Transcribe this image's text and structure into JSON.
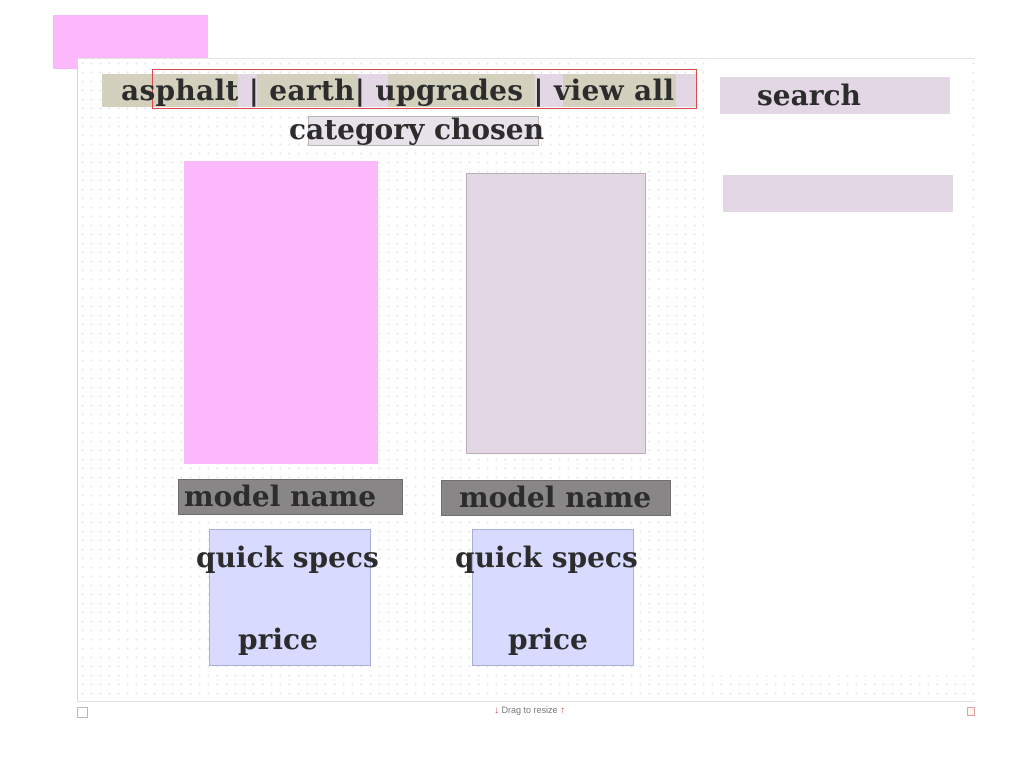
{
  "nav": {
    "items": [
      "asphalt",
      "earth",
      "upgrades",
      "view all"
    ],
    "separators": [
      "|",
      "|",
      "|"
    ]
  },
  "category": {
    "label": "category chosen"
  },
  "search": {
    "label": "search"
  },
  "products": [
    {
      "model_name": "model name",
      "quick_specs": "quick specs",
      "price": "price"
    },
    {
      "model_name": "model name",
      "quick_specs": "quick specs",
      "price": "price"
    }
  ],
  "status_bar": {
    "resize_hint": "Drag to resize"
  },
  "colors": {
    "pink": "#fbb9fc",
    "lavender": "#e3d7e6",
    "khaki": "#d3d1bd",
    "gray": "#888686",
    "periwinkle": "#d8dbff",
    "text": "#2c2c2c",
    "accent_red": "#d9494c"
  }
}
